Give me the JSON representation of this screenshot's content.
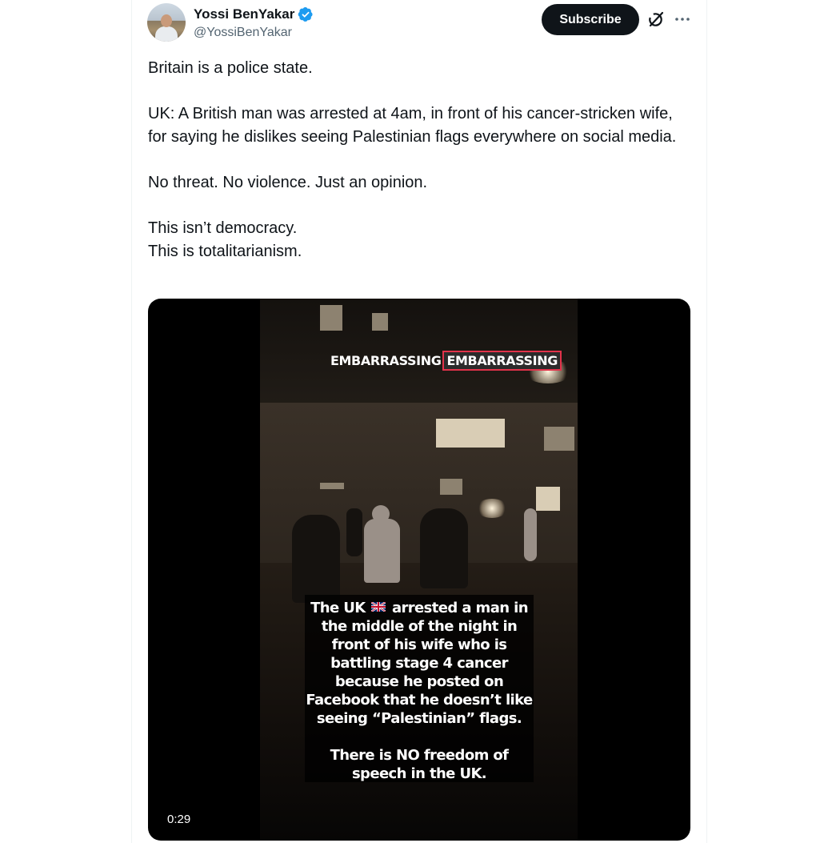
{
  "author": {
    "display_name": "Yossi BenYakar",
    "handle": "@YossiBenYakar",
    "verified": true,
    "verified_color": "#1d9bf0"
  },
  "actions": {
    "subscribe_label": "Subscribe",
    "grok_icon": "grok-icon",
    "more_icon": "more-icon"
  },
  "tweet": {
    "paragraphs": [
      "Britain is a police state.",
      "UK: A British man was arrested at 4am, in front of his cancer-stricken wife, for saying he dislikes seeing Palestinian flags everywhere on social media.",
      "No threat. No violence. Just an opinion."
    ],
    "closing_lines": [
      "This isn’t democracy.",
      "This is totalitarianism."
    ]
  },
  "video": {
    "duration": "0:29",
    "banner": {
      "part1": "EMBARRASSING",
      "part2": "EMBARRASSING",
      "highlight_color": "#e2324a"
    },
    "caption": {
      "line1_before_flag": "The UK",
      "line1_after_flag": "arrested a man in",
      "flag_icon": "uk-flag-icon",
      "lines": [
        "the middle of the night in",
        "front of his wife who is",
        "battling stage 4 cancer",
        "because he posted on",
        "Facebook that he doesn’t like",
        "seeing “Palestinian” flags."
      ],
      "closing_lines": [
        "There is NO freedom of",
        "speech in the UK."
      ]
    }
  }
}
